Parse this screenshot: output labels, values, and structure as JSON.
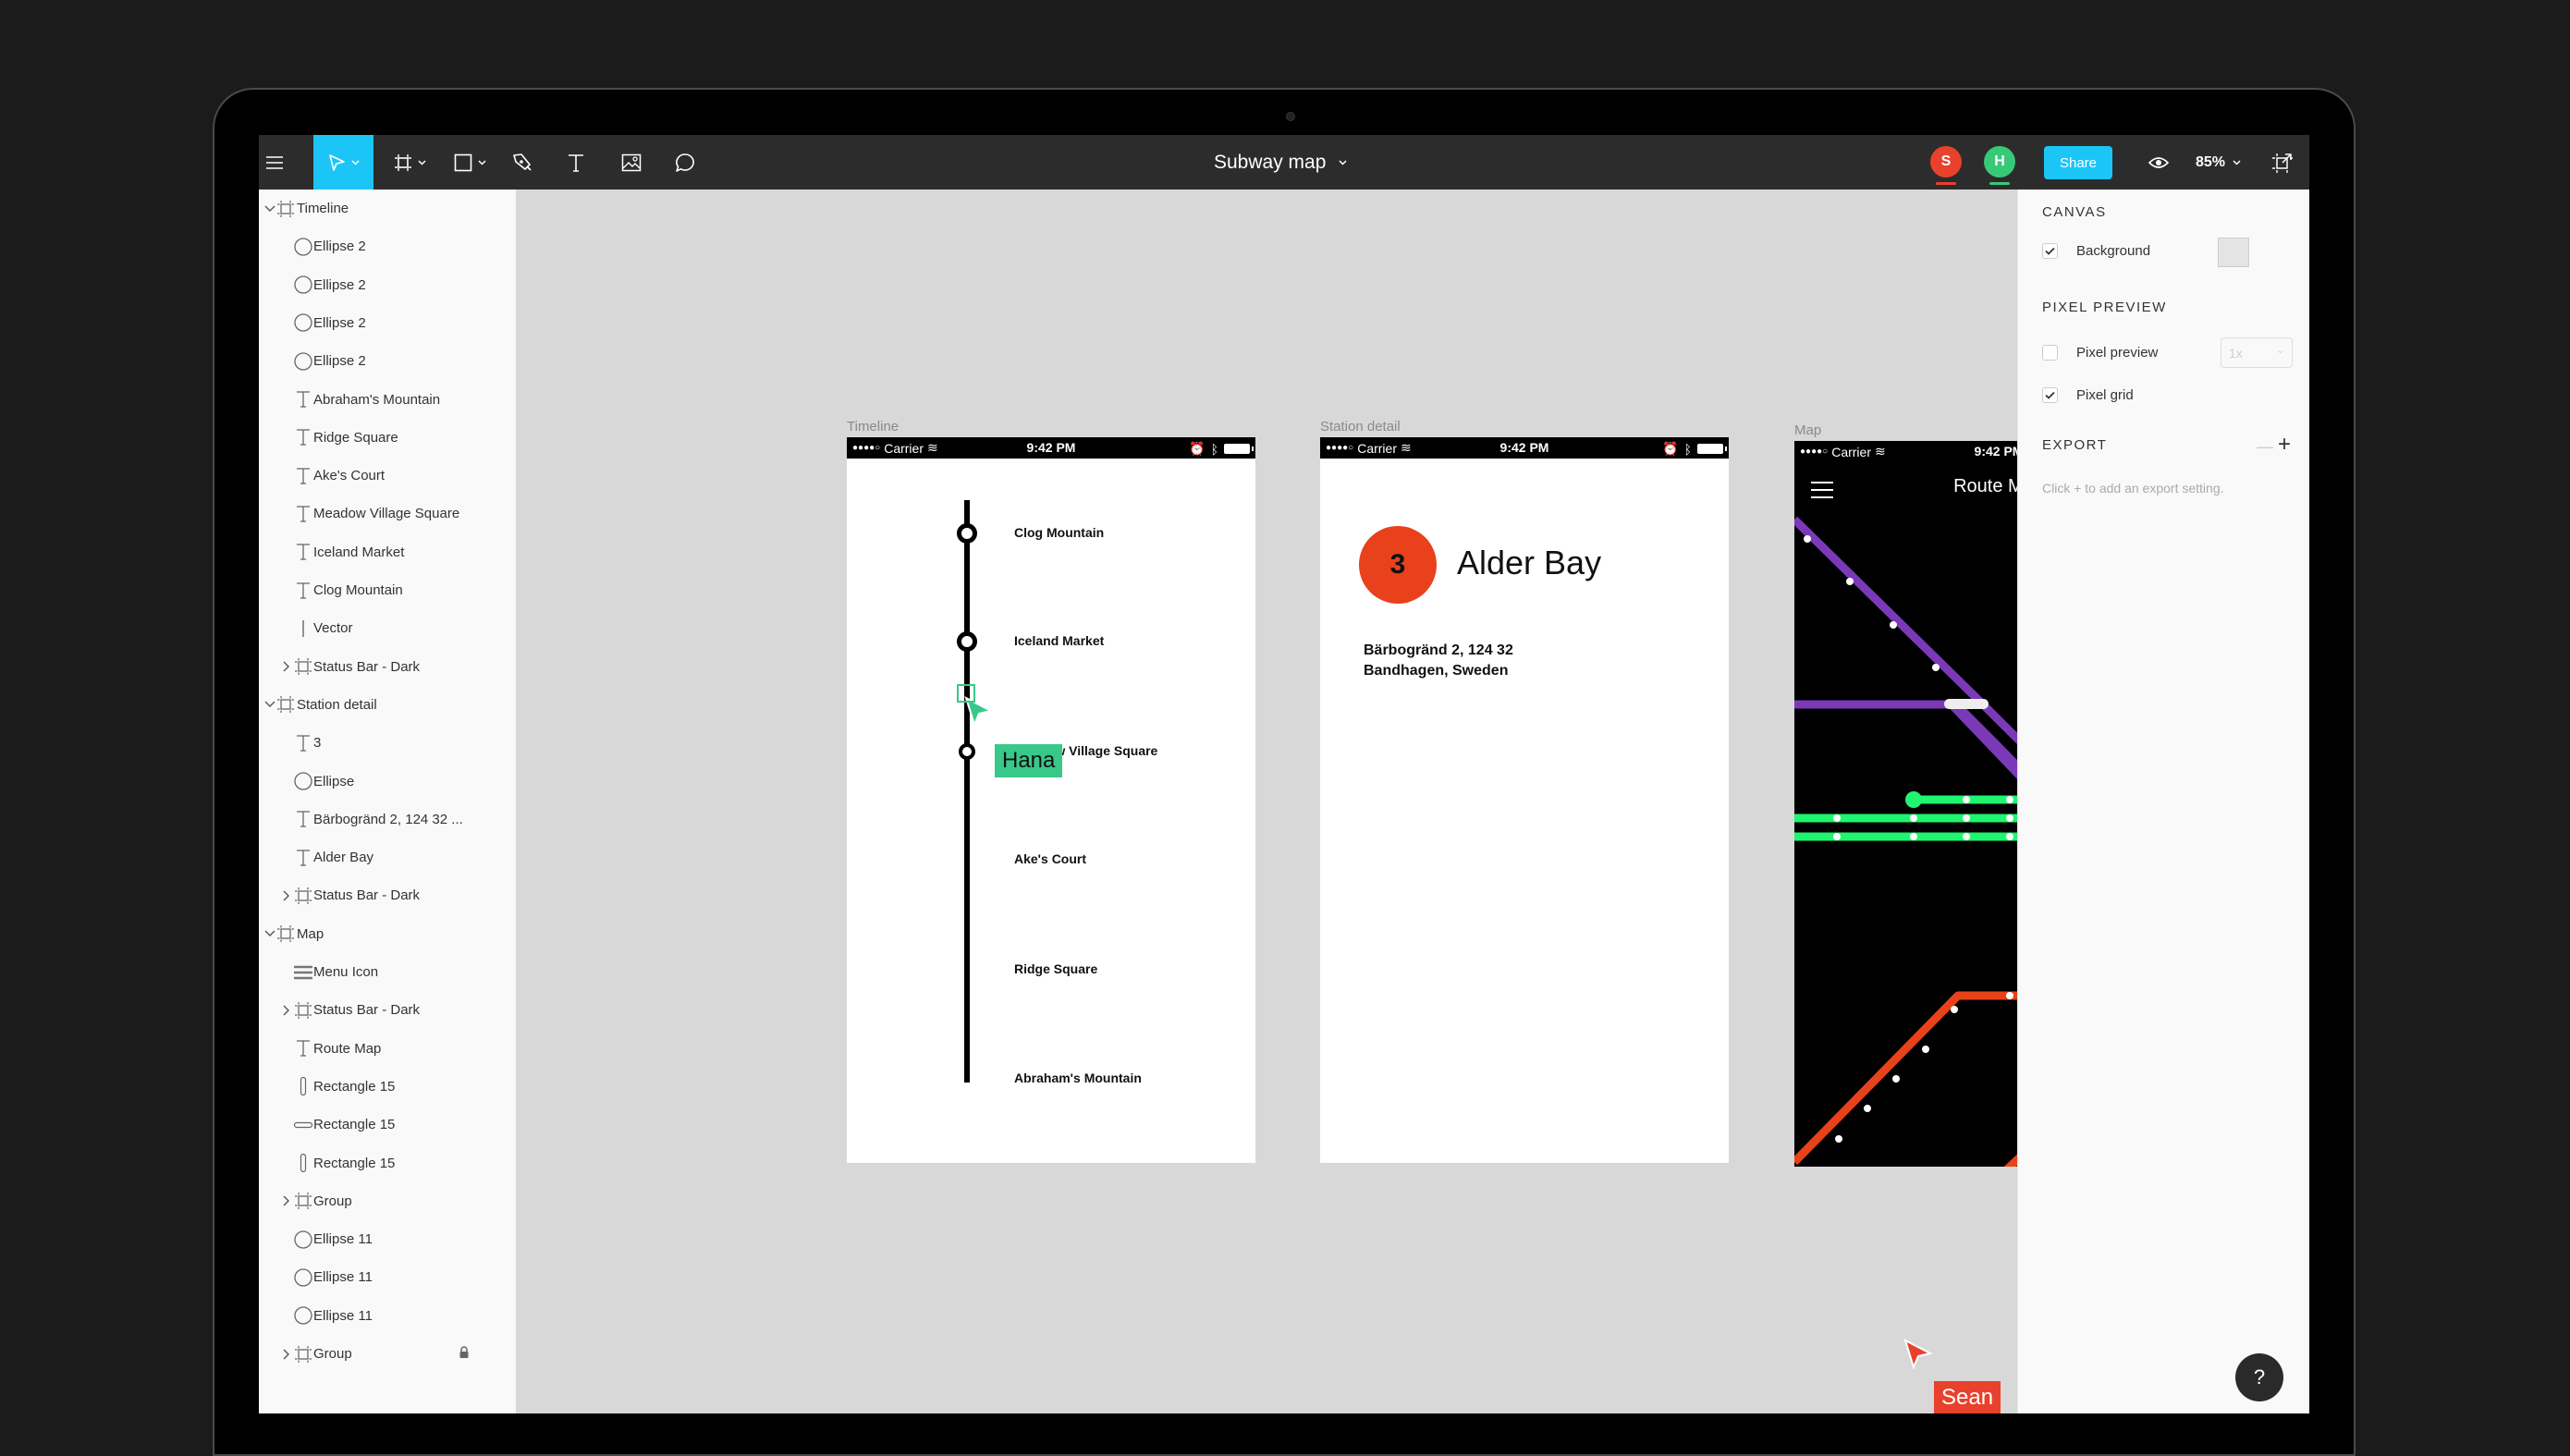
{
  "toolbar": {
    "menu_icon": "hamburger-icon",
    "tools": [
      {
        "name": "move-tool",
        "icon": "pointer-icon",
        "active": true,
        "has_dropdown": true
      },
      {
        "name": "frame-tool",
        "icon": "frame-icon",
        "has_dropdown": true
      },
      {
        "name": "shape-tool",
        "icon": "rectangle-icon",
        "has_dropdown": true
      },
      {
        "name": "pen-tool",
        "icon": "pen-icon"
      },
      {
        "name": "text-tool",
        "icon": "text-icon"
      },
      {
        "name": "image-tool",
        "icon": "image-icon"
      },
      {
        "name": "comment-tool",
        "icon": "comment-icon"
      }
    ],
    "document_title": "Subway map",
    "collaborators": [
      {
        "initial": "S",
        "color": "#e8412c"
      },
      {
        "initial": "H",
        "color": "#38c978"
      }
    ],
    "share_label": "Share",
    "share_color": "#1bc6f7",
    "zoom_level": "85%"
  },
  "layers": [
    {
      "label": "Timeline",
      "type": "frame",
      "depth": 0,
      "expanded": true
    },
    {
      "label": "Ellipse 2",
      "type": "ellipse",
      "depth": 1
    },
    {
      "label": "Ellipse 2",
      "type": "ellipse",
      "depth": 1
    },
    {
      "label": "Ellipse 2",
      "type": "ellipse",
      "depth": 1
    },
    {
      "label": "Ellipse 2",
      "type": "ellipse",
      "depth": 1
    },
    {
      "label": "Abraham's Mountain",
      "type": "text",
      "depth": 1
    },
    {
      "label": "Ridge Square",
      "type": "text",
      "depth": 1
    },
    {
      "label": "Ake's Court",
      "type": "text",
      "depth": 1
    },
    {
      "label": "Meadow Village Square",
      "type": "text",
      "depth": 1
    },
    {
      "label": "Iceland Market",
      "type": "text",
      "depth": 1
    },
    {
      "label": "Clog Mountain",
      "type": "text",
      "depth": 1
    },
    {
      "label": "Vector",
      "type": "vector",
      "depth": 1
    },
    {
      "label": "Status Bar - Dark",
      "type": "frame",
      "depth": 1,
      "expanded": false
    },
    {
      "label": "Station detail",
      "type": "frame",
      "depth": 0,
      "expanded": true
    },
    {
      "label": "3",
      "type": "text",
      "depth": 1
    },
    {
      "label": "Ellipse",
      "type": "ellipse",
      "depth": 1
    },
    {
      "label": "Bärbogränd 2, 124 32 ...",
      "type": "text",
      "depth": 1
    },
    {
      "label": "Alder Bay",
      "type": "text",
      "depth": 1
    },
    {
      "label": "Status Bar - Dark",
      "type": "frame",
      "depth": 1,
      "expanded": false
    },
    {
      "label": "Map",
      "type": "frame",
      "depth": 0,
      "expanded": true
    },
    {
      "label": "Menu Icon",
      "type": "menu",
      "depth": 1
    },
    {
      "label": "Status Bar - Dark",
      "type": "frame",
      "depth": 1,
      "expanded": false
    },
    {
      "label": "Route Map",
      "type": "text",
      "depth": 1
    },
    {
      "label": "Rectangle 15",
      "type": "rect-v",
      "depth": 1
    },
    {
      "label": "Rectangle 15",
      "type": "rect-h",
      "depth": 1
    },
    {
      "label": "Rectangle 15",
      "type": "rect-v",
      "depth": 1
    },
    {
      "label": "Group",
      "type": "frame",
      "depth": 1,
      "expanded": false
    },
    {
      "label": "Ellipse 11",
      "type": "ellipse",
      "depth": 1
    },
    {
      "label": "Ellipse 11",
      "type": "ellipse",
      "depth": 1
    },
    {
      "label": "Ellipse 11",
      "type": "ellipse",
      "depth": 1
    },
    {
      "label": "Group",
      "type": "frame",
      "depth": 1,
      "expanded": false,
      "locked": true
    }
  ],
  "frames": {
    "status_bar": {
      "signal": "●●●●○",
      "carrier": "Carrier",
      "time": "9:42 PM"
    },
    "timeline": {
      "label": "Timeline",
      "stations": [
        {
          "name": "Clog Mountain",
          "marker": true
        },
        {
          "name": "Iceland Market",
          "marker": true
        },
        {
          "name": "Meadow Village Square",
          "marker": true,
          "selected": true
        },
        {
          "name": "Ake's Court",
          "marker": false
        },
        {
          "name": "Ridge Square",
          "marker": false
        },
        {
          "name": "Abraham's Mountain",
          "marker": false
        }
      ]
    },
    "station_detail": {
      "label": "Station detail",
      "number": "3",
      "badge_color": "#e8411c",
      "name": "Alder Bay",
      "address_line1": "Bärbogränd 2, 124 32",
      "address_line2": "Bandhagen, Sweden"
    },
    "map": {
      "label": "Map",
      "title": "Route Map",
      "line_colors": {
        "purple": "#7a3ab8",
        "green": "#1ff56e",
        "red": "#e8421a"
      }
    }
  },
  "cursors": [
    {
      "name": "Hana",
      "color": "#38c98a",
      "text_color": "#111111"
    },
    {
      "name": "Sean",
      "color": "#e8412c",
      "text_color": "#ffffff"
    }
  ],
  "properties": {
    "canvas_title": "CANVAS",
    "background_label": "Background",
    "background_checked": true,
    "background_color": "#e4e4e4",
    "pixel_preview_title": "PIXEL PREVIEW",
    "pixel_preview_label": "Pixel preview",
    "pixel_preview_checked": false,
    "pixel_preview_scale": "1x",
    "pixel_grid_label": "Pixel grid",
    "pixel_grid_checked": true,
    "export_title": "EXPORT",
    "export_hint": "Click + to add an export setting."
  },
  "help_label": "?"
}
